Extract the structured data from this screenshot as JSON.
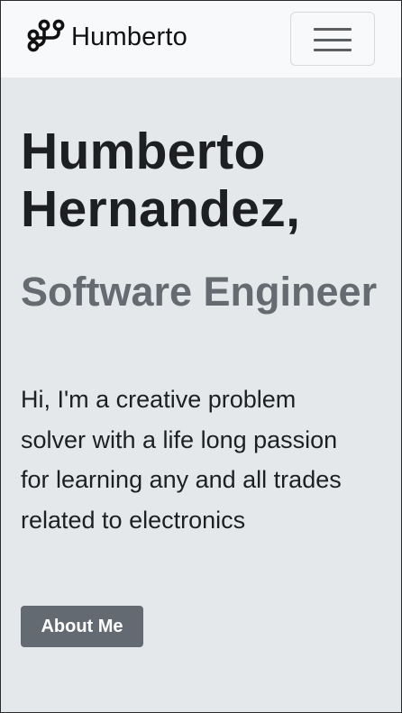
{
  "navbar": {
    "brand_text": "Humberto",
    "brand_icon": "git-branch-icon",
    "toggler_icon": "hamburger-menu-icon"
  },
  "hero": {
    "name": "Humberto Hernandez,",
    "role": "Software Engineer",
    "description": "Hi, I'm a creative problem solver with a life long passion for learning any and all trades related to electronics",
    "about_button_label": "About Me"
  },
  "colors": {
    "navbar_bg": "#f8f9fa",
    "hero_bg": "#e5e8eb",
    "heading_text": "#1e1f21",
    "subheading_text": "#656b71",
    "button_bg": "#646a71",
    "button_text": "#ffffff"
  }
}
